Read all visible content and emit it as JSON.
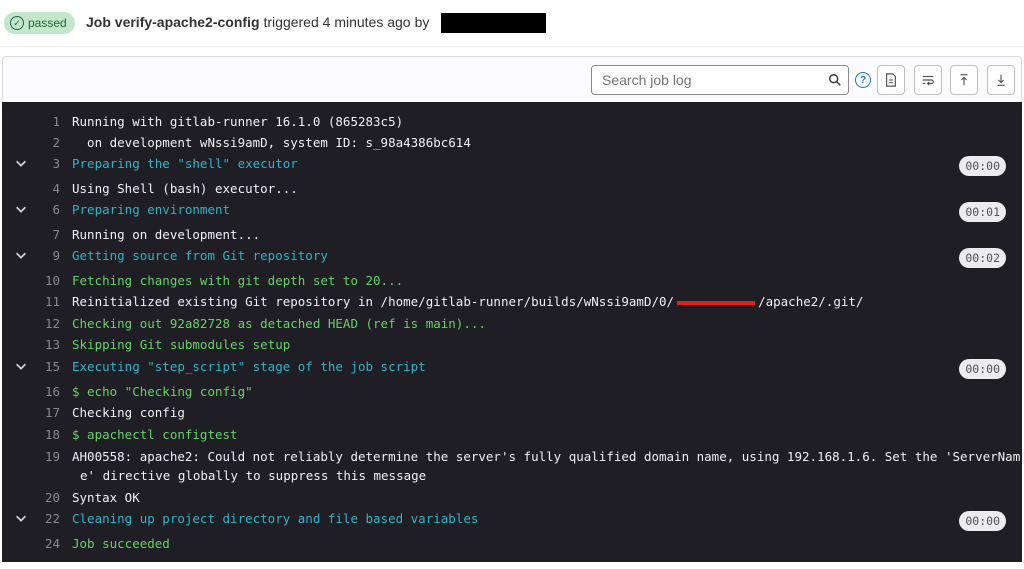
{
  "header": {
    "status": "passed",
    "job_name": "Job verify-apache2-config",
    "triggered": "triggered 4 minutes ago",
    "by": "by"
  },
  "toolbar": {
    "search_placeholder": "Search job log"
  },
  "log": {
    "lines": [
      {
        "n": "1",
        "text": "Running with gitlab-runner 16.1.0 (865283c5)",
        "color": "white"
      },
      {
        "n": "2",
        "text": "  on development wNssi9amD, system ID: s_98a4386bc614",
        "color": "white"
      },
      {
        "n": "3",
        "text": "Preparing the \"shell\" executor",
        "color": "cyan",
        "section": true,
        "duration": "00:00"
      },
      {
        "n": "4",
        "text": "Using Shell (bash) executor...",
        "color": "white"
      },
      {
        "n": "6",
        "text": "Preparing environment",
        "color": "cyan",
        "section": true,
        "duration": "00:01"
      },
      {
        "n": "7",
        "text": "Running on development...",
        "color": "white"
      },
      {
        "n": "9",
        "text": "Getting source from Git repository",
        "color": "cyan",
        "section": true,
        "duration": "00:02"
      },
      {
        "n": "10",
        "text": "Fetching changes with git depth set to 20...",
        "color": "green"
      },
      {
        "n": "11",
        "text_a": "Reinitialized existing Git repository in /home/gitlab-runner/builds/wNssi9amD/0/",
        "text_b": "/apache2/.git/",
        "color": "white"
      },
      {
        "n": "12",
        "text": "Checking out 92a82728 as detached HEAD (ref is main)...",
        "color": "green"
      },
      {
        "n": "13",
        "text": "Skipping Git submodules setup",
        "color": "green"
      },
      {
        "n": "15",
        "text": "Executing \"step_script\" stage of the job script",
        "color": "cyan",
        "section": true,
        "duration": "00:00"
      },
      {
        "n": "16",
        "text": "$ echo \"Checking config\"",
        "color": "green"
      },
      {
        "n": "17",
        "text": "Checking config",
        "color": "white"
      },
      {
        "n": "18",
        "text": "$ apachectl configtest",
        "color": "green"
      },
      {
        "n": "19",
        "text": "AH00558: apache2: Could not reliably determine the server's fully qualified domain name, using 192.168.1.6. Set the 'ServerNam",
        "text2": "e' directive globally to suppress this message",
        "color": "white"
      },
      {
        "n": "20",
        "text": "Syntax OK",
        "color": "white"
      },
      {
        "n": "22",
        "text": "Cleaning up project directory and file based variables",
        "color": "cyan",
        "section": true,
        "duration": "00:00"
      },
      {
        "n": "24",
        "text": "Job succeeded",
        "color": "green"
      }
    ]
  }
}
